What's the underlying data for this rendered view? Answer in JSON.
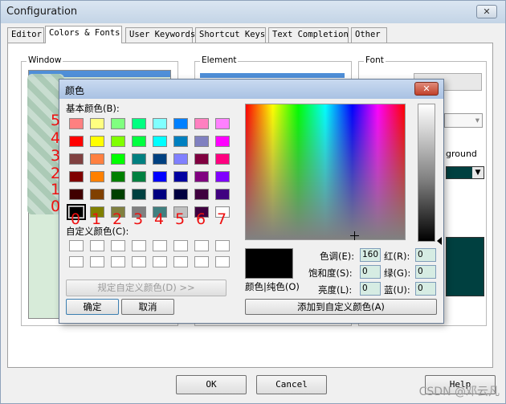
{
  "window": {
    "title": "Configuration",
    "close_label": "✕"
  },
  "tabs": [
    "Editor",
    "Colors & Fonts",
    "User Keywords",
    "Shortcut Keys",
    "Text Completion",
    "Other"
  ],
  "groups": {
    "window": "Window",
    "element": "Element",
    "font": "Font"
  },
  "background_label": "ground",
  "bottom_buttons": {
    "ok": "OK",
    "cancel": "Cancel",
    "help": "Help"
  },
  "dialog": {
    "title": "颜色",
    "close_label": "✕",
    "basic_colors_label": "基本颜色(B):",
    "custom_colors_label": "自定义颜色(C):",
    "define_custom_button": "规定自定义颜色(D) >>",
    "ok_button": "确定",
    "cancel_button": "取消",
    "solid_label": "颜色|纯色(O)",
    "add_custom_button": "添加到自定义颜色(A)",
    "hue_label": "色调(E):",
    "hue_value": "160",
    "sat_label": "饱和度(S):",
    "sat_value": "0",
    "lum_label": "亮度(L):",
    "lum_value": "0",
    "red_label": "红(R):",
    "red_value": "0",
    "green_label": "绿(G):",
    "green_value": "0",
    "blue_label": "蓝(U):",
    "blue_value": "0",
    "basic_colors": [
      [
        "#ff8080",
        "#ffff80",
        "#80ff80",
        "#00ff80",
        "#80ffff",
        "#0080ff",
        "#ff80c0",
        "#ff80ff"
      ],
      [
        "#ff0000",
        "#ffff00",
        "#80ff00",
        "#00ff40",
        "#00ffff",
        "#0080c0",
        "#8080c0",
        "#ff00ff"
      ],
      [
        "#804040",
        "#ff8040",
        "#00ff00",
        "#008080",
        "#004080",
        "#8080ff",
        "#800040",
        "#ff0080"
      ],
      [
        "#800000",
        "#ff8000",
        "#008000",
        "#008040",
        "#0000ff",
        "#0000a0",
        "#800080",
        "#8000ff"
      ],
      [
        "#400000",
        "#804000",
        "#004000",
        "#004040",
        "#000080",
        "#000040",
        "#400040",
        "#400080"
      ],
      [
        "#000000",
        "#808000",
        "#808040",
        "#808080",
        "#408080",
        "#c0c0c0",
        "#400040",
        "#ffffff"
      ]
    ],
    "selected_color": "#000000"
  },
  "annotations": {
    "rows": [
      "5",
      "4",
      "3",
      "2",
      "1",
      "0"
    ],
    "cols": [
      "0",
      "1",
      "2",
      "3",
      "4",
      "5",
      "6",
      "7"
    ]
  },
  "watermark": "CSDN @邓云凡"
}
